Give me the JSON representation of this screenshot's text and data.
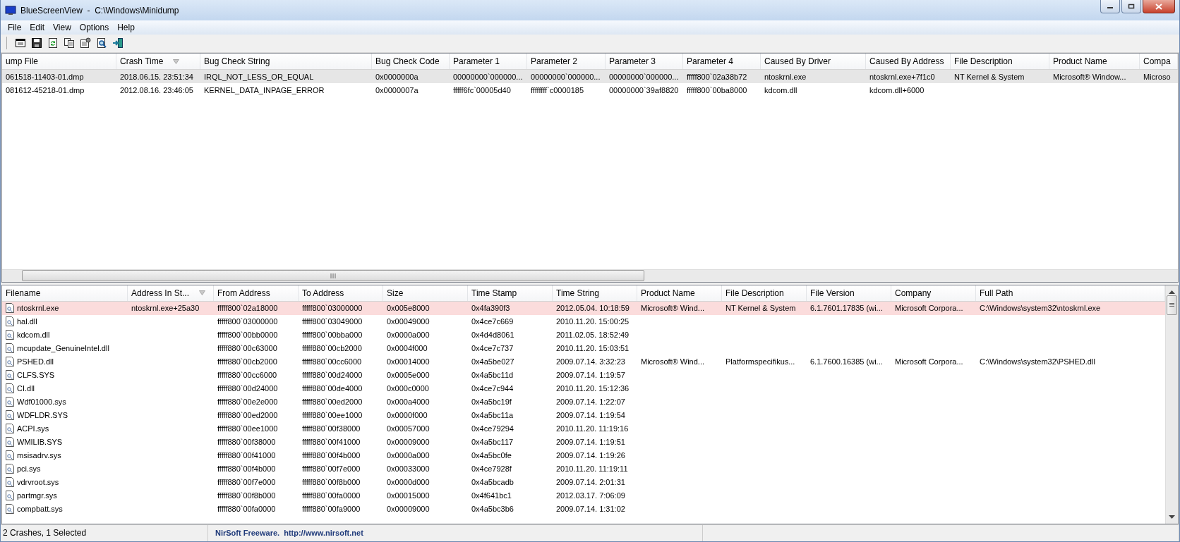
{
  "window": {
    "title": "BlueScreenView  -  C:\\Windows\\Minidump"
  },
  "menu": [
    "File",
    "Edit",
    "View",
    "Options",
    "Help"
  ],
  "crashes": {
    "columns": [
      {
        "label": "ump File",
        "sort_indicator": false
      },
      {
        "label": "Crash Time",
        "sort_indicator": true
      },
      {
        "label": "Bug Check String",
        "sort_indicator": false
      },
      {
        "label": "Bug Check Code",
        "sort_indicator": false
      },
      {
        "label": "Parameter 1",
        "sort_indicator": false
      },
      {
        "label": "Parameter 2",
        "sort_indicator": false
      },
      {
        "label": "Parameter 3",
        "sort_indicator": false
      },
      {
        "label": "Parameter 4",
        "sort_indicator": false
      },
      {
        "label": "Caused By Driver",
        "sort_indicator": false
      },
      {
        "label": "Caused By Address",
        "sort_indicator": false
      },
      {
        "label": "File Description",
        "sort_indicator": false
      },
      {
        "label": "Product Name",
        "sort_indicator": false
      },
      {
        "label": "Compa",
        "sort_indicator": false
      }
    ],
    "rows": [
      {
        "selected": true,
        "cells": [
          "061518-11403-01.dmp",
          "2018.06.15. 23:51:34",
          "IRQL_NOT_LESS_OR_EQUAL",
          "0x0000000a",
          "00000000`000000...",
          "00000000`000000...",
          "00000000`000000...",
          "fffff800`02a38b72",
          "ntoskrnl.exe",
          "ntoskrnl.exe+7f1c0",
          "NT Kernel & System",
          "Microsoft® Window...",
          "Microso"
        ]
      },
      {
        "selected": false,
        "cells": [
          "081612-45218-01.dmp",
          "2012.08.16. 23:46:05",
          "KERNEL_DATA_INPAGE_ERROR",
          "0x0000007a",
          "fffff6fc`00005d40",
          "ffffffff`c0000185",
          "00000000`39af8820",
          "fffff800`00ba8000",
          "kdcom.dll",
          "kdcom.dll+6000"
        ]
      }
    ]
  },
  "modules": {
    "columns": [
      {
        "label": "Filename",
        "sort_indicator": false
      },
      {
        "label": "Address In St...",
        "sort_indicator": true
      },
      {
        "label": "From Address",
        "sort_indicator": false
      },
      {
        "label": "To Address",
        "sort_indicator": false
      },
      {
        "label": "Size",
        "sort_indicator": false
      },
      {
        "label": "Time Stamp",
        "sort_indicator": false
      },
      {
        "label": "Time String",
        "sort_indicator": false
      },
      {
        "label": "Product Name",
        "sort_indicator": false
      },
      {
        "label": "File Description",
        "sort_indicator": false
      },
      {
        "label": "File Version",
        "sort_indicator": false
      },
      {
        "label": "Company",
        "sort_indicator": false
      },
      {
        "label": "Full Path",
        "sort_indicator": false
      }
    ],
    "rows": [
      {
        "highlighted": true,
        "cells": [
          "ntoskrnl.exe",
          "ntoskrnl.exe+25a30",
          "fffff800`02a18000",
          "fffff800`03000000",
          "0x005e8000",
          "0x4fa390f3",
          "2012.05.04. 10:18:59",
          "Microsoft® Wind...",
          "NT Kernel & System",
          "6.1.7601.17835 (wi...",
          "Microsoft Corpora...",
          "C:\\Windows\\system32\\ntoskrnl.exe"
        ]
      },
      {
        "highlighted": false,
        "cells": [
          "hal.dll",
          null,
          "fffff800`03000000",
          "fffff800`03049000",
          "0x00049000",
          "0x4ce7c669",
          "2010.11.20. 15:00:25"
        ]
      },
      {
        "highlighted": false,
        "cells": [
          "kdcom.dll",
          null,
          "fffff800`00bb0000",
          "fffff800`00bba000",
          "0x0000a000",
          "0x4d4d8061",
          "2011.02.05. 18:52:49"
        ]
      },
      {
        "highlighted": false,
        "cells": [
          "mcupdate_GenuineIntel.dll",
          null,
          "fffff880`00c63000",
          "fffff880`00cb2000",
          "0x0004f000",
          "0x4ce7c737",
          "2010.11.20. 15:03:51"
        ]
      },
      {
        "highlighted": false,
        "cells": [
          "PSHED.dll",
          null,
          "fffff880`00cb2000",
          "fffff880`00cc6000",
          "0x00014000",
          "0x4a5be027",
          "2009.07.14. 3:32:23",
          "Microsoft® Wind...",
          "Platformspecifikus...",
          "6.1.7600.16385 (wi...",
          "Microsoft Corpora...",
          "C:\\Windows\\system32\\PSHED.dll"
        ]
      },
      {
        "highlighted": false,
        "cells": [
          "CLFS.SYS",
          null,
          "fffff880`00cc6000",
          "fffff880`00d24000",
          "0x0005e000",
          "0x4a5bc11d",
          "2009.07.14. 1:19:57"
        ]
      },
      {
        "highlighted": false,
        "cells": [
          "CI.dll",
          null,
          "fffff880`00d24000",
          "fffff880`00de4000",
          "0x000c0000",
          "0x4ce7c944",
          "2010.11.20. 15:12:36"
        ]
      },
      {
        "highlighted": false,
        "cells": [
          "Wdf01000.sys",
          null,
          "fffff880`00e2e000",
          "fffff880`00ed2000",
          "0x000a4000",
          "0x4a5bc19f",
          "2009.07.14. 1:22:07"
        ]
      },
      {
        "highlighted": false,
        "cells": [
          "WDFLDR.SYS",
          null,
          "fffff880`00ed2000",
          "fffff880`00ee1000",
          "0x0000f000",
          "0x4a5bc11a",
          "2009.07.14. 1:19:54"
        ]
      },
      {
        "highlighted": false,
        "cells": [
          "ACPI.sys",
          null,
          "fffff880`00ee1000",
          "fffff880`00f38000",
          "0x00057000",
          "0x4ce79294",
          "2010.11.20. 11:19:16"
        ]
      },
      {
        "highlighted": false,
        "cells": [
          "WMILIB.SYS",
          null,
          "fffff880`00f38000",
          "fffff880`00f41000",
          "0x00009000",
          "0x4a5bc117",
          "2009.07.14. 1:19:51"
        ]
      },
      {
        "highlighted": false,
        "cells": [
          "msisadrv.sys",
          null,
          "fffff880`00f41000",
          "fffff880`00f4b000",
          "0x0000a000",
          "0x4a5bc0fe",
          "2009.07.14. 1:19:26"
        ]
      },
      {
        "highlighted": false,
        "cells": [
          "pci.sys",
          null,
          "fffff880`00f4b000",
          "fffff880`00f7e000",
          "0x00033000",
          "0x4ce7928f",
          "2010.11.20. 11:19:11"
        ]
      },
      {
        "highlighted": false,
        "cells": [
          "vdrvroot.sys",
          null,
          "fffff880`00f7e000",
          "fffff880`00f8b000",
          "0x0000d000",
          "0x4a5bcadb",
          "2009.07.14. 2:01:31"
        ]
      },
      {
        "highlighted": false,
        "cells": [
          "partmgr.sys",
          null,
          "fffff880`00f8b000",
          "fffff880`00fa0000",
          "0x00015000",
          "0x4f641bc1",
          "2012.03.17. 7:06:09"
        ]
      },
      {
        "highlighted": false,
        "cells": [
          "compbatt.sys",
          null,
          "fffff880`00fa0000",
          "fffff880`00fa9000",
          "0x00009000",
          "0x4a5bc3b6",
          "2009.07.14. 1:31:02"
        ]
      }
    ]
  },
  "status_bar": {
    "summary": "2 Crashes, 1 Selected",
    "credit": "NirSoft Freeware.  http://www.nirsoft.net"
  }
}
